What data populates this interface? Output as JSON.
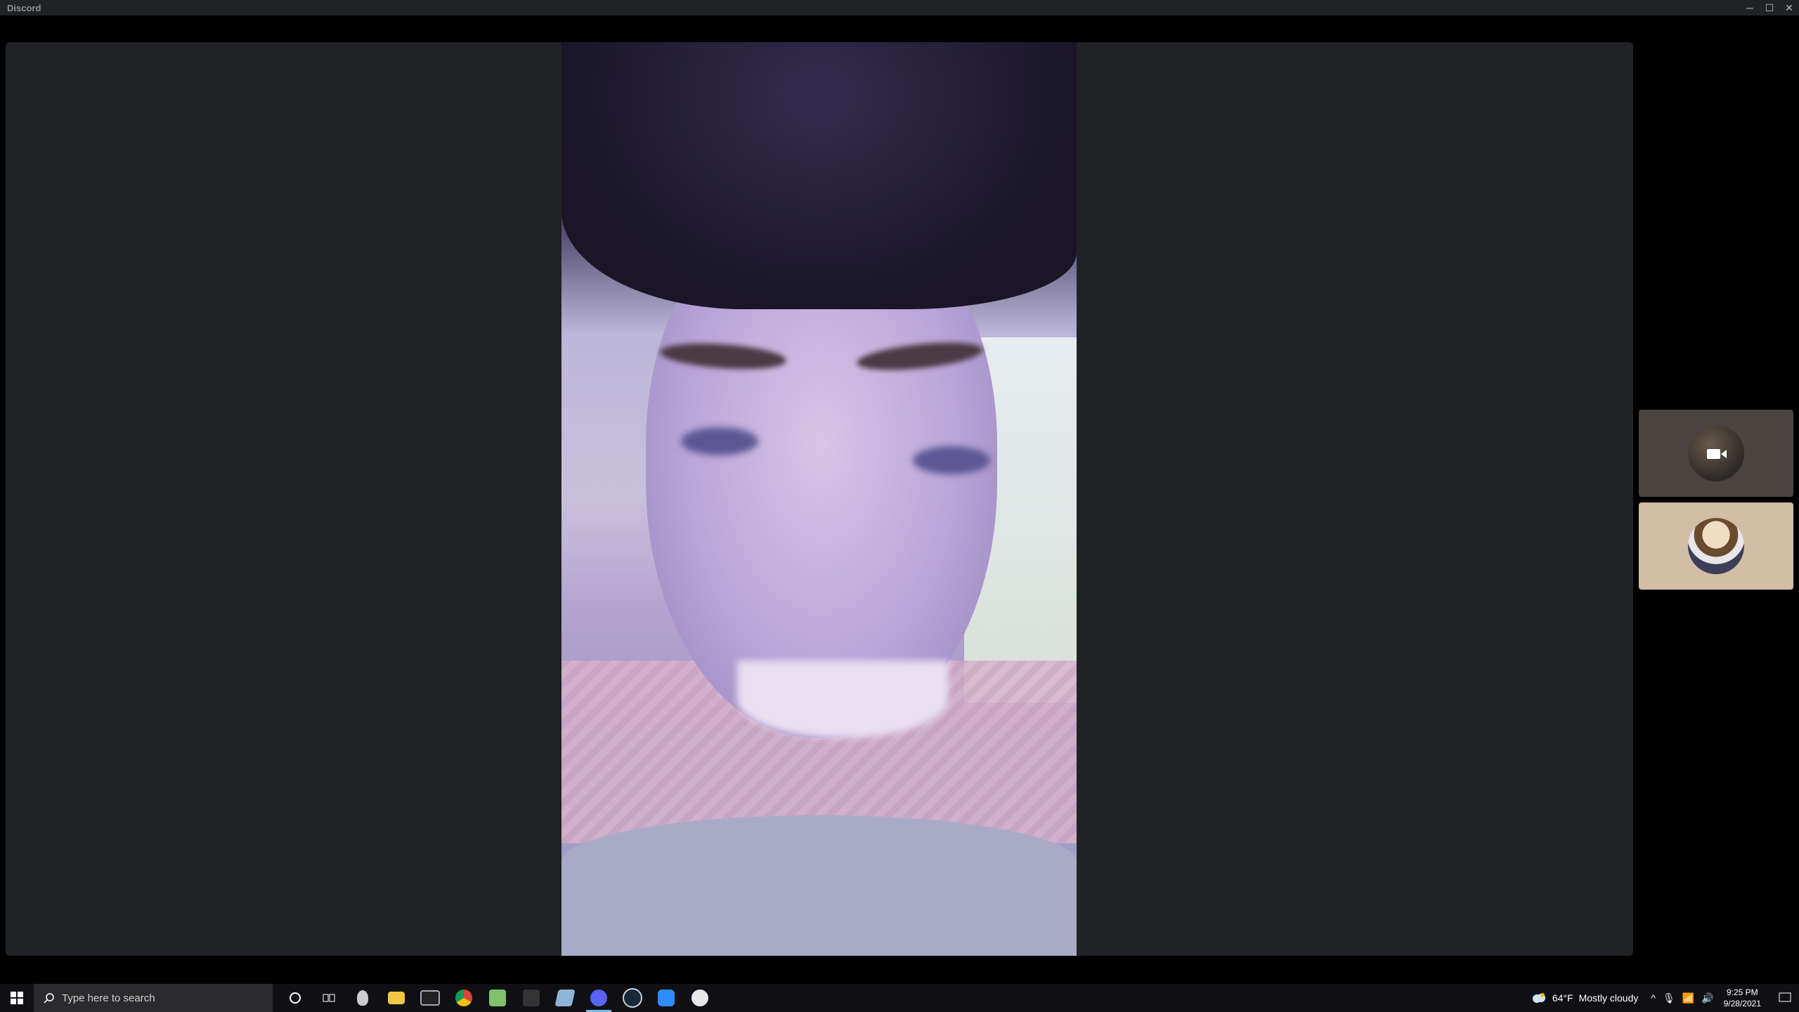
{
  "window": {
    "title": "Discord",
    "controls": {
      "minimize": "─",
      "maximize": "☐",
      "close": "✕"
    }
  },
  "call": {
    "main_video_participant": "camera-feed",
    "side_tiles": [
      {
        "kind": "video-off-avatar",
        "icon": "video-camera-icon"
      },
      {
        "kind": "avatar"
      }
    ]
  },
  "taskbar": {
    "search_placeholder": "Type here to search",
    "pinned_icons": [
      "cortana-icon",
      "task-view-icon",
      "alienware-icon",
      "file-explorer-icon",
      "terminal-icon",
      "chrome-icon",
      "notepad-icon",
      "app-icon",
      "app-icon-2",
      "discord-icon",
      "steam-icon",
      "zoom-icon",
      "app-icon-3"
    ],
    "weather": {
      "temp": "64°F",
      "condition": "Mostly cloudy"
    },
    "time": "9:25 PM",
    "date": "9/28/2021"
  },
  "colors": {
    "accent": "#5865f2",
    "background": "#202225",
    "taskbar": "#101014"
  }
}
